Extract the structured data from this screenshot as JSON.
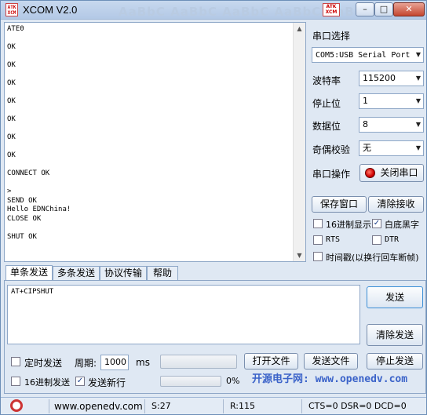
{
  "window": {
    "icon_text": "ATK\nXCM",
    "title": "XCOM V2.0",
    "ghost_title": "AaBbC  AaBbC  AaBbC  AaBbC  AaBb",
    "logo_text": "ATK\nXCM",
    "min_glyph": "–",
    "max_glyph": "□",
    "close_glyph": "✕"
  },
  "receive": {
    "text": "ATE0\n\nOK\n\nOK\n\nOK\n\nOK\n\nOK\n\nOK\n\nOK\n\nCONNECT OK\n\n>\nSEND OK\nHello EDNChina!\nCLOSE OK\n\nSHUT OK"
  },
  "settings": {
    "port_label": "串口选择",
    "port_value": "COM5:USB Serial Port",
    "baud_label": "波特率",
    "baud_value": "115200",
    "stopbits_label": "停止位",
    "stopbits_value": "1",
    "databits_label": "数据位",
    "databits_value": "8",
    "parity_label": "奇偶校验",
    "parity_value": "无",
    "operation_label": "串口操作",
    "close_port_button": "关闭串口",
    "save_window_button": "保存窗口",
    "clear_receive_button": "清除接收",
    "hex_display_label": "16进制显示",
    "white_black_label": "白底黑字",
    "rts_label": "RTS",
    "dtr_label": "DTR",
    "timestamp_label": "时间戳(以换行回车断帧)",
    "dropdown_glyph": "▼"
  },
  "tabs": [
    "单条发送",
    "多条发送",
    "协议传输",
    "帮助"
  ],
  "send": {
    "text": "AT+CIPSHUT",
    "send_button": "发送",
    "clear_send_button": "清除发送",
    "timed_send_label": "定时发送",
    "period_label": "周期:",
    "period_value": "1000",
    "period_unit": "ms",
    "open_file_button": "打开文件",
    "send_file_button": "发送文件",
    "stop_send_button": "停止发送",
    "hex_send_label": "16进制发送",
    "send_newline_label": "发送新行",
    "progress_text": "0%",
    "watermark": "开源电子网: www.openedv.com"
  },
  "status": {
    "website": "www.openedv.com",
    "sent": "S:27",
    "received": "R:115",
    "signals": "CTS=0 DSR=0 DCD=0"
  }
}
